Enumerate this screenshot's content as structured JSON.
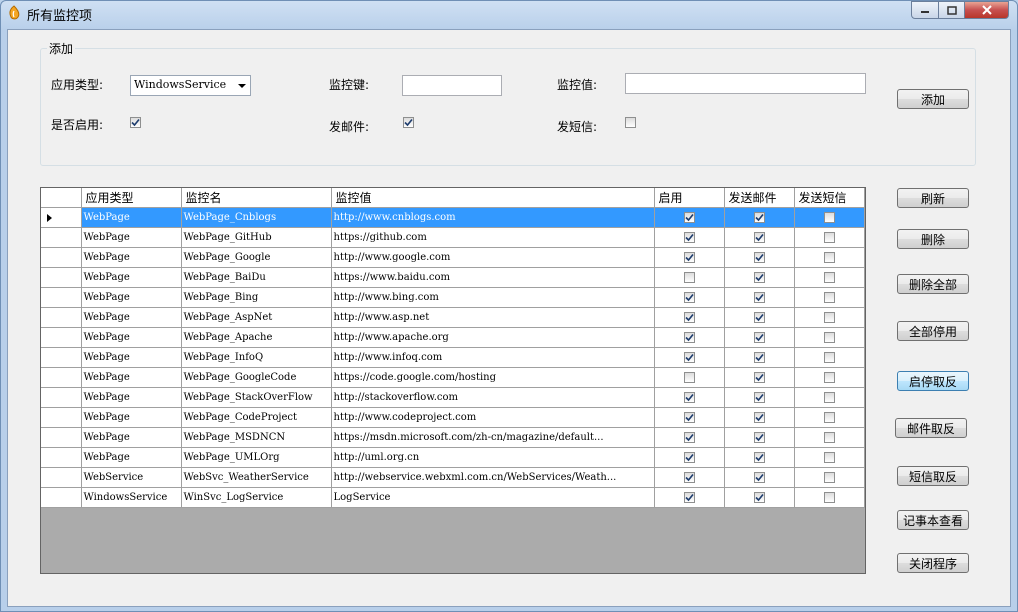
{
  "window": {
    "title": "所有监控项"
  },
  "add_group": {
    "title": "添加",
    "app_type_label": "应用类型:",
    "app_type_value": "WindowsService",
    "monitor_key_label": "监控键:",
    "monitor_key_value": "",
    "monitor_value_label": "监控值:",
    "monitor_value_value": "",
    "enabled_label": "是否启用:",
    "enabled_checked": true,
    "send_mail_label": "发邮件:",
    "send_mail_checked": true,
    "send_sms_label": "发短信:",
    "send_sms_checked": false,
    "add_button": "添加"
  },
  "grid": {
    "columns": [
      "应用类型",
      "监控名",
      "监控值",
      "启用",
      "发送邮件",
      "发送短信"
    ],
    "rows": [
      {
        "type": "WebPage",
        "name": "WebPage_Cnblogs",
        "value": "http://www.cnblogs.com",
        "enabled": true,
        "mail": true,
        "sms": false
      },
      {
        "type": "WebPage",
        "name": "WebPage_GitHub",
        "value": "https://github.com",
        "enabled": true,
        "mail": true,
        "sms": false
      },
      {
        "type": "WebPage",
        "name": "WebPage_Google",
        "value": "http://www.google.com",
        "enabled": true,
        "mail": true,
        "sms": false
      },
      {
        "type": "WebPage",
        "name": "WebPage_BaiDu",
        "value": "https://www.baidu.com",
        "enabled": false,
        "mail": true,
        "sms": false
      },
      {
        "type": "WebPage",
        "name": "WebPage_Bing",
        "value": "http://www.bing.com",
        "enabled": true,
        "mail": true,
        "sms": false
      },
      {
        "type": "WebPage",
        "name": "WebPage_AspNet",
        "value": "http://www.asp.net",
        "enabled": true,
        "mail": true,
        "sms": false
      },
      {
        "type": "WebPage",
        "name": "WebPage_Apache",
        "value": "http://www.apache.org",
        "enabled": true,
        "mail": true,
        "sms": false
      },
      {
        "type": "WebPage",
        "name": "WebPage_InfoQ",
        "value": "http://www.infoq.com",
        "enabled": true,
        "mail": true,
        "sms": false
      },
      {
        "type": "WebPage",
        "name": "WebPage_GoogleCode",
        "value": "https://code.google.com/hosting",
        "enabled": false,
        "mail": true,
        "sms": false
      },
      {
        "type": "WebPage",
        "name": "WebPage_StackOverFlow",
        "value": "http://stackoverflow.com",
        "enabled": true,
        "mail": true,
        "sms": false
      },
      {
        "type": "WebPage",
        "name": "WebPage_CodeProject",
        "value": "http://www.codeproject.com",
        "enabled": true,
        "mail": true,
        "sms": false
      },
      {
        "type": "WebPage",
        "name": "WebPage_MSDNCN",
        "value": "https://msdn.microsoft.com/zh-cn/magazine/default...",
        "enabled": true,
        "mail": true,
        "sms": false
      },
      {
        "type": "WebPage",
        "name": "WebPage_UMLOrg",
        "value": "http://uml.org.cn",
        "enabled": true,
        "mail": true,
        "sms": false
      },
      {
        "type": "WebService",
        "name": "WebSvc_WeatherService",
        "value": "http://webservice.webxml.com.cn/WebServices/Weath...",
        "enabled": true,
        "mail": true,
        "sms": false
      },
      {
        "type": "WindowsService",
        "name": "WinSvc_LogService",
        "value": "LogService",
        "enabled": true,
        "mail": true,
        "sms": false
      }
    ],
    "selected_row": 0
  },
  "side_buttons": {
    "refresh": "刷新",
    "delete": "删除",
    "delete_all": "删除全部",
    "disable_all": "全部停用",
    "toggle_enabled": "启停取反",
    "toggle_mail": "邮件取反",
    "toggle_sms": "短信取反",
    "open_notepad": "记事本查看",
    "close_app": "关闭程序"
  }
}
